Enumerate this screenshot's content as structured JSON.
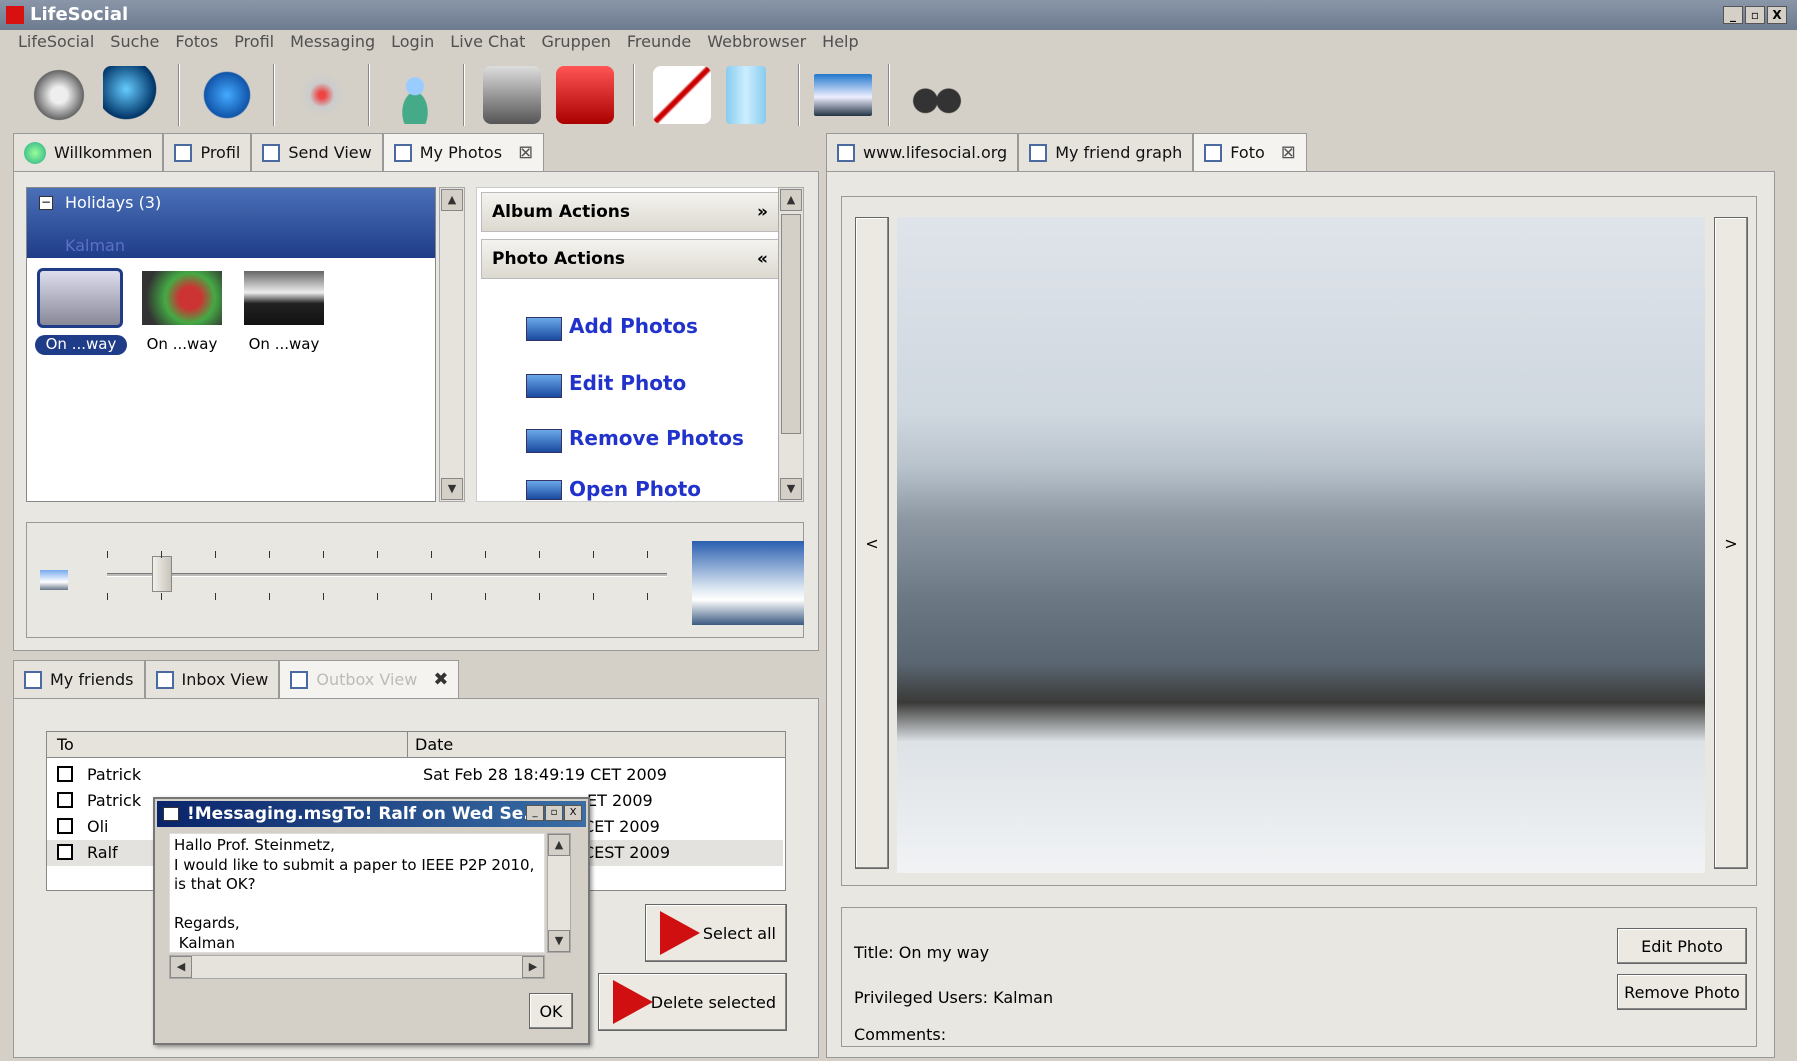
{
  "app": {
    "title": "LifeSocial",
    "win_buttons": [
      "_",
      "▫",
      "X"
    ]
  },
  "menu": [
    "LifeSocial",
    "Suche",
    "Fotos",
    "Profil",
    "Messaging",
    "Login",
    "Live Chat",
    "Gruppen",
    "Freunde",
    "Webbrowser",
    "Help"
  ],
  "toolbar_icons": [
    "settings-gear-icon",
    "globe-icon",
    "browser-icon",
    "network-icon",
    "users-icon",
    "tools-icon",
    "lock-icon",
    "edit-pencil-icon",
    "document-icon",
    "photo-icon",
    "binoculars-icon"
  ],
  "left_tabs": [
    {
      "label": "Willkommen"
    },
    {
      "label": "Profil"
    },
    {
      "label": "Send View"
    },
    {
      "label": "My Photos",
      "close": "⊠"
    }
  ],
  "album": {
    "group": "Holidays (3)",
    "user": "Kalman",
    "thumbs": [
      "On ...way",
      "On ...way",
      "On ...way"
    ]
  },
  "actions": {
    "album_header": "Album Actions",
    "photo_header": "Photo Actions",
    "items": [
      "Add Photos",
      "Edit Photo",
      "Remove Photos",
      "Open Photo"
    ]
  },
  "slider": {
    "value_fraction": 0.08
  },
  "bottom_tabs": [
    {
      "label": "My friends"
    },
    {
      "label": "Inbox View"
    },
    {
      "label": "Outbox View",
      "close": "✖"
    }
  ],
  "outbox": {
    "col_to": "To",
    "col_date": "Date",
    "rows": [
      {
        "to": "Patrick",
        "date": "Sat Feb 28 18:49:19 CET 2009"
      },
      {
        "to": "Patrick",
        "date": "ET 2009"
      },
      {
        "to": "Oli",
        "date": "CET 2009"
      },
      {
        "to": "Ralf",
        "date": "CEST 2009"
      }
    ],
    "select_all": "Select all",
    "delete_selected": "Delete selected"
  },
  "dialog": {
    "title": "!Messaging.msgTo! Ralf on Wed Se...",
    "body": "Hallo Prof. Steinmetz,\nI would like to submit a paper to IEEE P2P 2010,\nis that OK?\n\nRegards,\n Kalman",
    "ok": "OK"
  },
  "right_tabs": [
    {
      "label": "www.lifesocial.org"
    },
    {
      "label": "My friend graph"
    },
    {
      "label": "Foto",
      "close": "⊠"
    }
  ],
  "photo": {
    "prev": "<",
    "next": ">",
    "title": "Title: On my way",
    "privileged": "Privileged Users: Kalman",
    "comments": "Comments:",
    "edit": "Edit Photo",
    "remove": "Remove Photo"
  }
}
